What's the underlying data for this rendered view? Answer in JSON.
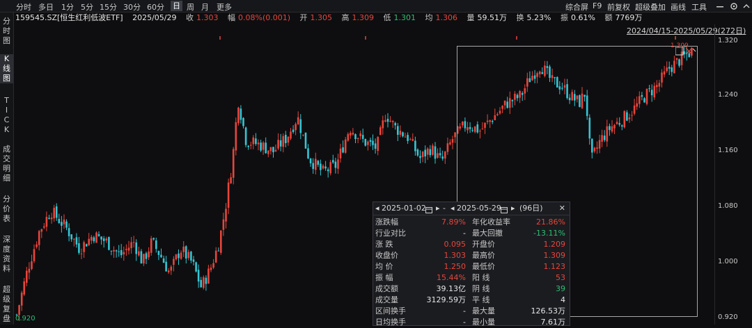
{
  "toolbar": {
    "periods": [
      "分时",
      "多日",
      "1分",
      "5分",
      "15分",
      "30分",
      "60分",
      "日",
      "周",
      "月",
      "更多"
    ],
    "active_period": "日",
    "right_items": [
      "综合屏",
      "F9",
      "前复权",
      "超级叠加",
      "画线",
      "工具"
    ]
  },
  "quote": {
    "symbol": "159545.SZ[恒生红利低波ETF]",
    "date": "2025/05/29",
    "close_label": "收",
    "close": "1.303",
    "change_label": "幅",
    "change": "0.08%(0.001)",
    "open_label": "开",
    "open": "1.305",
    "high_label": "高",
    "high": "1.309",
    "low_label": "低",
    "low": "1.301",
    "avg_label": "均",
    "avg": "1.306",
    "volume_label": "量",
    "volume": "59.51万",
    "turnover_label": "换",
    "turnover": "5.23%",
    "amplitude_label": "振",
    "amplitude": "0.61%",
    "amount_label": "额",
    "amount": "7769万"
  },
  "left_rail": [
    "分时图",
    "K线图",
    "TICK",
    "成交明细",
    "分价表",
    "深度资料",
    "超级复盘"
  ],
  "chart": {
    "range_label": "2024/04/15-2025/05/29(272日)",
    "y_ticks": [
      "1.320",
      "1.240",
      "1.160",
      "1.080",
      "1.000",
      "0.920"
    ],
    "last_low_label": "0.920",
    "high_marker": "1.309",
    "colors": {
      "up": "#e8453c",
      "down": "#35c6d4",
      "bg": "#0e0e10"
    }
  },
  "popup": {
    "start_date": "2025-01-02",
    "end_date": "2025-05-29",
    "days": "(96日)",
    "rows": [
      {
        "k1": "涨跌幅",
        "v1": "7.89%",
        "c1": "red",
        "k2": "年化收益率",
        "v2": "21.86%",
        "c2": "red"
      },
      {
        "k1": "行业对比",
        "v1": "-",
        "c1": "white",
        "k2": "最大回撤",
        "v2": "-13.11%",
        "c2": "green"
      },
      {
        "k1": "涨 跌",
        "v1": "0.095",
        "c1": "red",
        "k2": "开盘价",
        "v2": "1.209",
        "c2": "red"
      },
      {
        "k1": "收盘价",
        "v1": "1.303",
        "c1": "red",
        "k2": "最高价",
        "v2": "1.309",
        "c2": "red"
      },
      {
        "k1": "均 价",
        "v1": "1.250",
        "c1": "red",
        "k2": "最低价",
        "v2": "1.123",
        "c2": "red"
      },
      {
        "k1": "振 幅",
        "v1": "15.44%",
        "c1": "red",
        "k2": "阳 线",
        "v2": "53",
        "c2": "red"
      },
      {
        "k1": "成交额",
        "v1": "39.13亿",
        "c1": "white",
        "k2": "阴 线",
        "v2": "39",
        "c2": "green"
      },
      {
        "k1": "成交量",
        "v1": "3129.59万",
        "c1": "white",
        "k2": "平 线",
        "v2": "4",
        "c2": "white"
      },
      {
        "k1": "区间换手",
        "v1": "-",
        "c1": "white",
        "k2": "最大量",
        "v2": "126.53万",
        "c2": "white"
      },
      {
        "k1": "日均换手",
        "v1": "-",
        "c1": "white",
        "k2": "最小量",
        "v2": "7.61万",
        "c2": "white"
      }
    ]
  }
}
